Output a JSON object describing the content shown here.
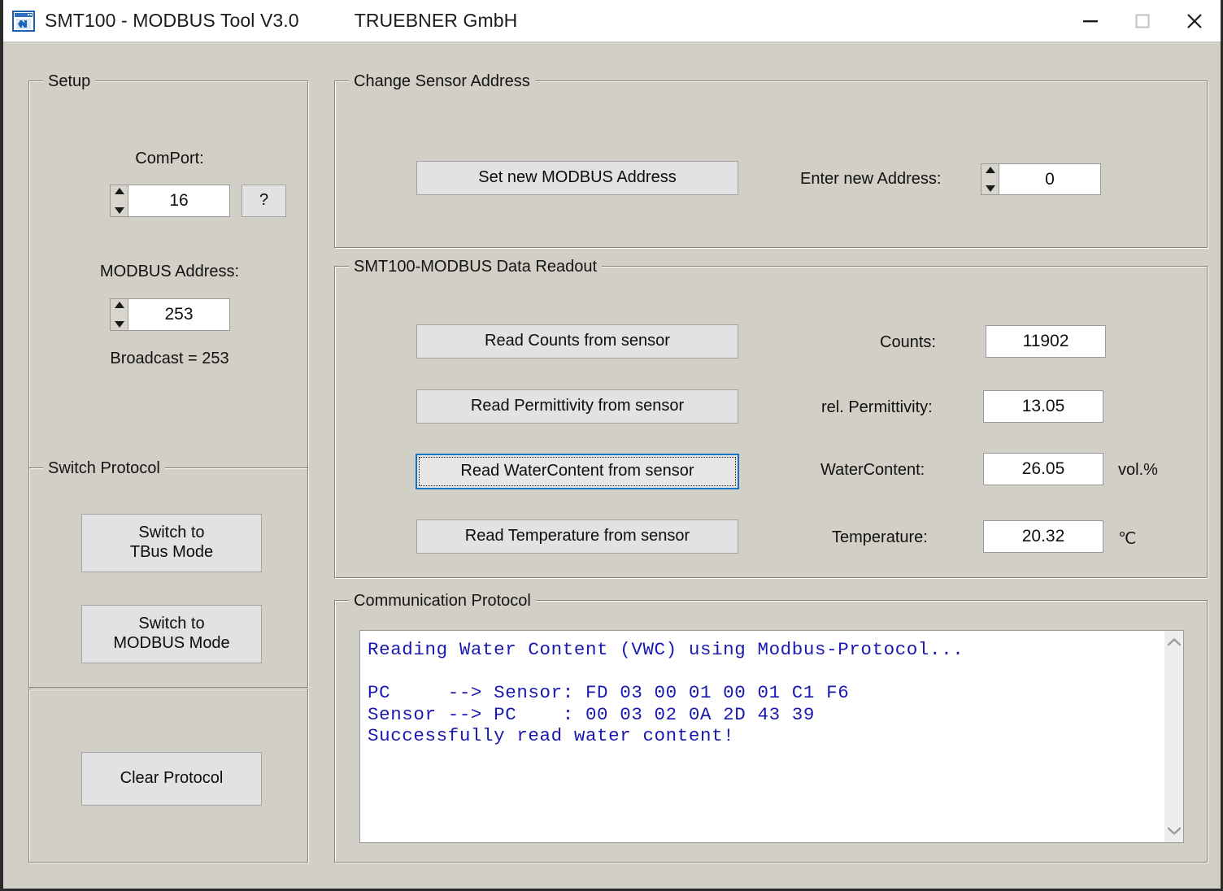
{
  "window": {
    "title": "SMT100 - MODBUS Tool  V3.0",
    "company": "TRUEBNER GmbH",
    "icon": "app-window-icon",
    "controls": {
      "minimize": "minimize-icon",
      "maximize": "maximize-icon",
      "close": "close-icon"
    }
  },
  "setup": {
    "group_title": "Setup",
    "comport_label": "ComPort:",
    "comport_value": "16",
    "help_button": "?",
    "modbus_address_label": "MODBUS Address:",
    "modbus_address_value": "253",
    "broadcast_note": "Broadcast = 253"
  },
  "switch_protocol": {
    "group_title": "Switch Protocol",
    "tbus_button": "Switch to\nTBus Mode",
    "modbus_button": "Switch to\nMODBUS Mode"
  },
  "clear_section": {
    "clear_button": "Clear Protocol"
  },
  "change_sensor_address": {
    "group_title": "Change Sensor Address",
    "set_button": "Set new MODBUS Address",
    "enter_label": "Enter new Address:",
    "enter_value": "0"
  },
  "data_readout": {
    "group_title": "SMT100-MODBUS Data Readout",
    "rows": [
      {
        "button": "Read Counts from sensor",
        "label": "Counts:",
        "value": "11902",
        "unit": "",
        "focused": false
      },
      {
        "button": "Read Permittivity from sensor",
        "label": "rel. Permittivity:",
        "value": "13.05",
        "unit": "",
        "focused": false
      },
      {
        "button": "Read WaterContent from sensor",
        "label": "WaterContent:",
        "value": "26.05",
        "unit": "vol.%",
        "focused": true
      },
      {
        "button": "Read Temperature from sensor",
        "label": "Temperature:",
        "value": "20.32",
        "unit": "℃",
        "focused": false
      }
    ]
  },
  "communication_protocol": {
    "group_title": "Communication Protocol",
    "log_text": "Reading Water Content (VWC) using Modbus-Protocol...\n\nPC     --> Sensor: FD 03 00 01 00 01 C1 F6\nSensor --> PC    : 00 03 02 0A 2D 43 39\nSuccessfully read water content!",
    "scroll_up": "chevron-up-icon",
    "scroll_down": "chevron-down-icon"
  },
  "colors": {
    "window_background": "#d2cfc6",
    "button_face": "#e2e2e2",
    "focus_border": "#1272c8",
    "protocol_text": "#1919b0",
    "field_background": "#ffffff"
  }
}
